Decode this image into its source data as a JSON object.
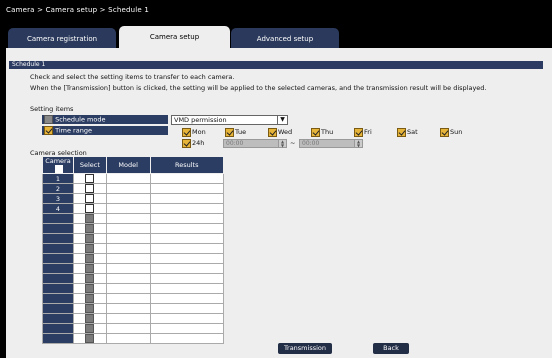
{
  "breadcrumb": "Camera > Camera setup > Schedule 1",
  "tabs": [
    "Camera registration",
    "Camera setup",
    "Advanced setup"
  ],
  "section_title": "Schedule 1",
  "desc1": "Check and select the setting items to transfer to each camera.",
  "desc2": "When the [Transmission] button is clicked, the setting will be applied to the selected cameras, and the transmission result will be displayed.",
  "setting_items_heading": "Setting items",
  "schedule_mode_label": "Schedule mode",
  "schedule_mode_value": "VMD permission",
  "time_range_label": "Time range",
  "days": [
    "Mon",
    "Tue",
    "Wed",
    "Thu",
    "Fri",
    "Sat",
    "Sun"
  ],
  "h24_label": "24h",
  "time_from": "00:00",
  "time_sep": "~",
  "time_to": "00:00",
  "camera_selection_heading": "Camera selection",
  "table_headers": {
    "camera": "Camera",
    "select": "Select",
    "model": "Model",
    "results": "Results"
  },
  "camera_rows": [
    "1",
    "2",
    "3",
    "4",
    "",
    "",
    "",
    "",
    "",
    "",
    "",
    "",
    "",
    "",
    "",
    "",
    ""
  ],
  "buttons": {
    "transmission": "Transmission",
    "back": "Back"
  }
}
